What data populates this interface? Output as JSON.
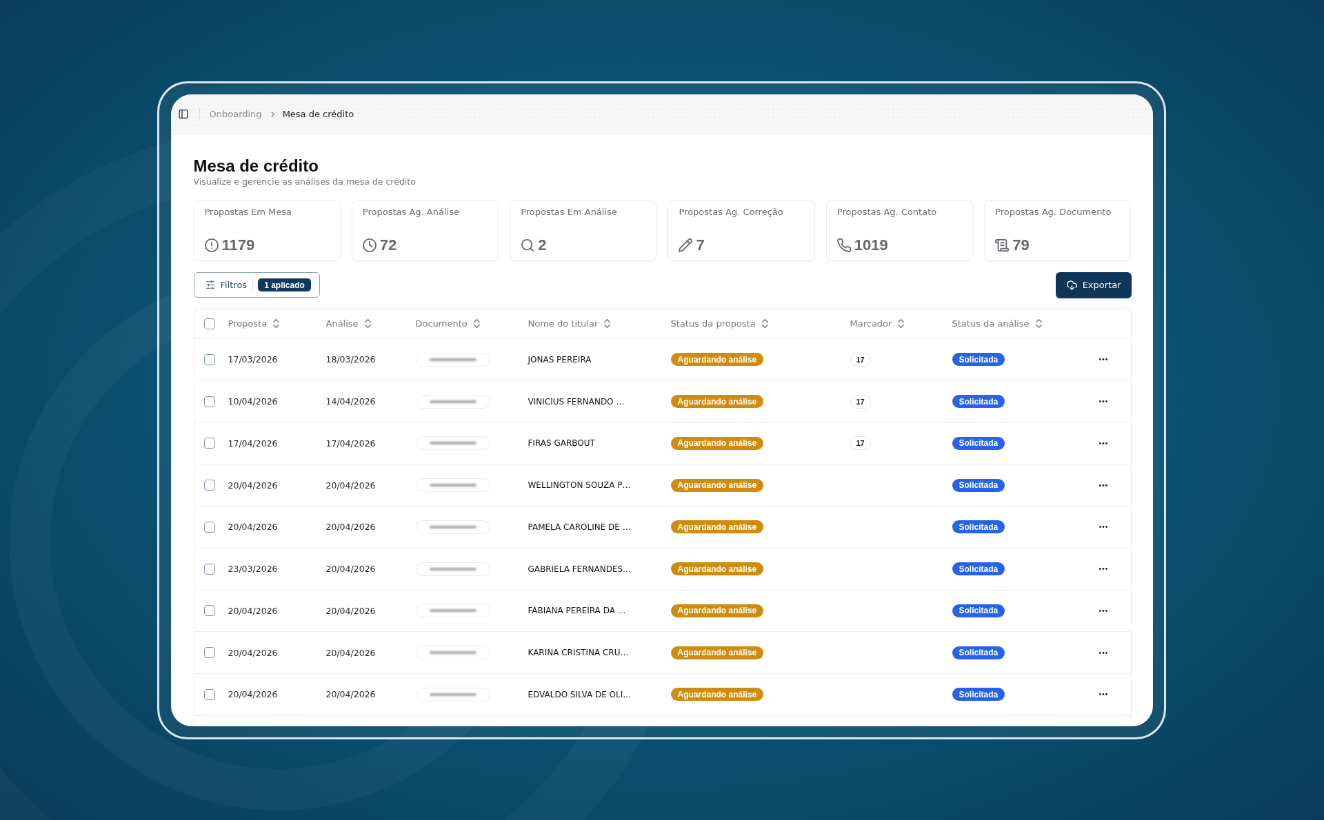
{
  "header": {
    "breadcrumb": [
      {
        "label": "Onboarding",
        "current": false
      },
      {
        "label": "Mesa de crédito",
        "current": true
      }
    ]
  },
  "page": {
    "title": "Mesa de crédito",
    "subtitle": "Visualize e gerencie as análises da mesa de crédito"
  },
  "stats": [
    {
      "kind": "queue",
      "label": "Propostas Em Mesa",
      "value": "1179"
    },
    {
      "kind": "pending",
      "label": "Propostas Ag. Análise",
      "value": "72"
    },
    {
      "kind": "review",
      "label": "Propostas Em Análise",
      "value": "2"
    },
    {
      "kind": "correction",
      "label": "Propostas Ag. Correção",
      "value": "7"
    },
    {
      "kind": "contact",
      "label": "Propostas Ag. Contato",
      "value": "1019"
    },
    {
      "kind": "document",
      "label": "Propostas Ag. Documento",
      "value": "79"
    }
  ],
  "toolbar": {
    "filter": {
      "label": "Filtros",
      "applied": "1 aplicado"
    },
    "export": {
      "label": "Exportar"
    }
  },
  "table": {
    "select_all": {
      "checked": false
    },
    "columns": [
      {
        "label": "Proposta",
        "sortable": true
      },
      {
        "label": "Análise",
        "sortable": true
      },
      {
        "label": "Documento",
        "sortable": true
      },
      {
        "label": "Nome do titular",
        "sortable": true
      },
      {
        "label": "Status da proposta",
        "sortable": true
      },
      {
        "label": "Marcador",
        "sortable": true
      },
      {
        "label": "Status da análise",
        "sortable": true
      }
    ],
    "rows": [
      {
        "checked": false,
        "proposta": "17/03/2026",
        "analise": "18/03/2026",
        "titular": "JONAS PEREIRA",
        "status_proposta": "Aguardando análise",
        "marcador": "17",
        "status_analise": "Solicitada"
      },
      {
        "checked": false,
        "proposta": "10/04/2026",
        "analise": "14/04/2026",
        "titular": "VINICIUS FERNANDO …",
        "status_proposta": "Aguardando análise",
        "marcador": "17",
        "status_analise": "Solicitada"
      },
      {
        "checked": false,
        "proposta": "17/04/2026",
        "analise": "17/04/2026",
        "titular": "FIRAS GARBOUT",
        "status_proposta": "Aguardando análise",
        "marcador": "17",
        "status_analise": "Solicitada"
      },
      {
        "checked": false,
        "proposta": "20/04/2026",
        "analise": "20/04/2026",
        "titular": "WELLINGTON SOUZA P…",
        "status_proposta": "Aguardando análise",
        "status_analise": "Solicitada"
      },
      {
        "checked": false,
        "proposta": "20/04/2026",
        "analise": "20/04/2026",
        "titular": "PAMELA CAROLINE DE …",
        "status_proposta": "Aguardando análise",
        "status_analise": "Solicitada"
      },
      {
        "checked": false,
        "proposta": "23/03/2026",
        "analise": "20/04/2026",
        "titular": "GABRIELA FERNANDES…",
        "status_proposta": "Aguardando análise",
        "status_analise": "Solicitada"
      },
      {
        "checked": false,
        "proposta": "20/04/2026",
        "analise": "20/04/2026",
        "titular": "FABIANA PEREIRA DA …",
        "status_proposta": "Aguardando análise",
        "status_analise": "Solicitada"
      },
      {
        "checked": false,
        "proposta": "20/04/2026",
        "analise": "20/04/2026",
        "titular": "KARINA CRISTINA CRU…",
        "status_proposta": "Aguardando análise",
        "status_analise": "Solicitada"
      },
      {
        "checked": false,
        "proposta": "20/04/2026",
        "analise": "20/04/2026",
        "titular": "EDVALDO SILVA DE OLI…",
        "status_proposta": "Aguardando análise",
        "status_analise": "Solicitada"
      }
    ]
  }
}
